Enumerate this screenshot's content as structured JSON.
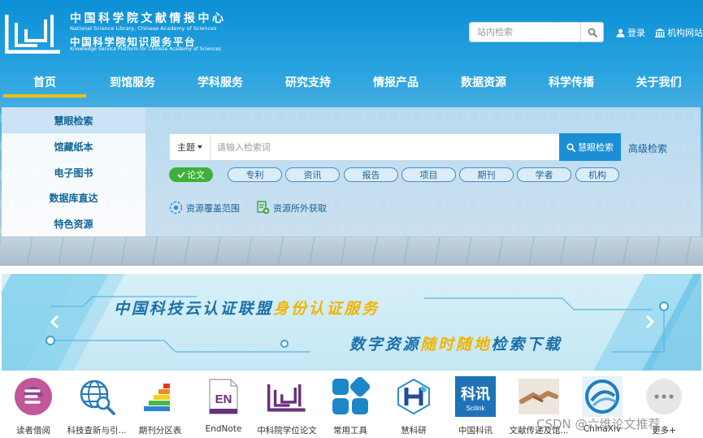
{
  "header": {
    "logo": {
      "cn_name": "中国科学院文献情报中心",
      "en_name": "National Science Library, Chinese Academy of Sciences",
      "platform_cn": "中国科学院知识服务平台",
      "platform_en": "Knowledge Service Platform for Chinese Academy of Sciences"
    },
    "site_search": {
      "placeholder": "站内检索",
      "icon": "search-icon"
    },
    "login_label": "登录",
    "institution_label": "机构网站"
  },
  "nav": {
    "items": [
      "首页",
      "到馆服务",
      "学科服务",
      "研究支持",
      "情报产品",
      "数据资源",
      "科学传播",
      "关于我们"
    ],
    "active_index": 0,
    "accent_color": "#f0c010"
  },
  "left_menu": {
    "items": [
      "慧眼检索",
      "馆藏纸本",
      "电子图书",
      "数据库直达",
      "特色资源"
    ],
    "active_index": 0
  },
  "search": {
    "type_label": "主题",
    "placeholder": "请输入检索词",
    "search_button": "慧眼检索",
    "advanced_link": "高级检索",
    "chips": [
      "论文",
      "专利",
      "资讯",
      "报告",
      "项目",
      "期刊",
      "学者",
      "机构"
    ],
    "active_chip_index": 0,
    "links": [
      {
        "label": "资源覆盖范围",
        "icon": "coverage-icon"
      },
      {
        "label": "资源所外获取",
        "icon": "document-add-icon"
      }
    ],
    "button_color": "#1a8fd6",
    "chip_active_color": "#3fb039"
  },
  "banner": {
    "line1_plain": "中国科技云认证联盟",
    "line1_highlight": "身份认证服务",
    "line2_plain_start": "数字资源",
    "line2_highlight": "随时随地",
    "line2_plain_end": "检索下载",
    "highlight_color": "#f0b400",
    "prev_icon": "chevron-left-icon",
    "next_icon": "chevron-right-icon"
  },
  "quick_links": {
    "items": [
      {
        "label": "读者借阅",
        "icon": "reader-borrow-icon"
      },
      {
        "label": "科技查新与引...",
        "icon": "globe-search-icon"
      },
      {
        "label": "期刊分区表",
        "icon": "bar-pyramid-icon"
      },
      {
        "label": "EndNote",
        "icon": "endnote-icon",
        "icon_text": "EN"
      },
      {
        "label": "中科院学位论文",
        "icon": "thesis-logo-icon"
      },
      {
        "label": "常用工具",
        "icon": "tools-grid-icon"
      },
      {
        "label": "慧科研",
        "icon": "hui-research-icon"
      },
      {
        "label": "中国科讯",
        "icon": "sciknow-icon",
        "icon_text": "科讯",
        "icon_subtext": "Scilink"
      },
      {
        "label": "文献传递及馆...",
        "icon": "handshake-icon"
      },
      {
        "label": "ChinaXiv",
        "icon": "chinaxiv-icon"
      },
      {
        "label": "更多+",
        "icon": "more-dots-icon"
      }
    ]
  },
  "watermark": "CSDN @六维论文推荐"
}
